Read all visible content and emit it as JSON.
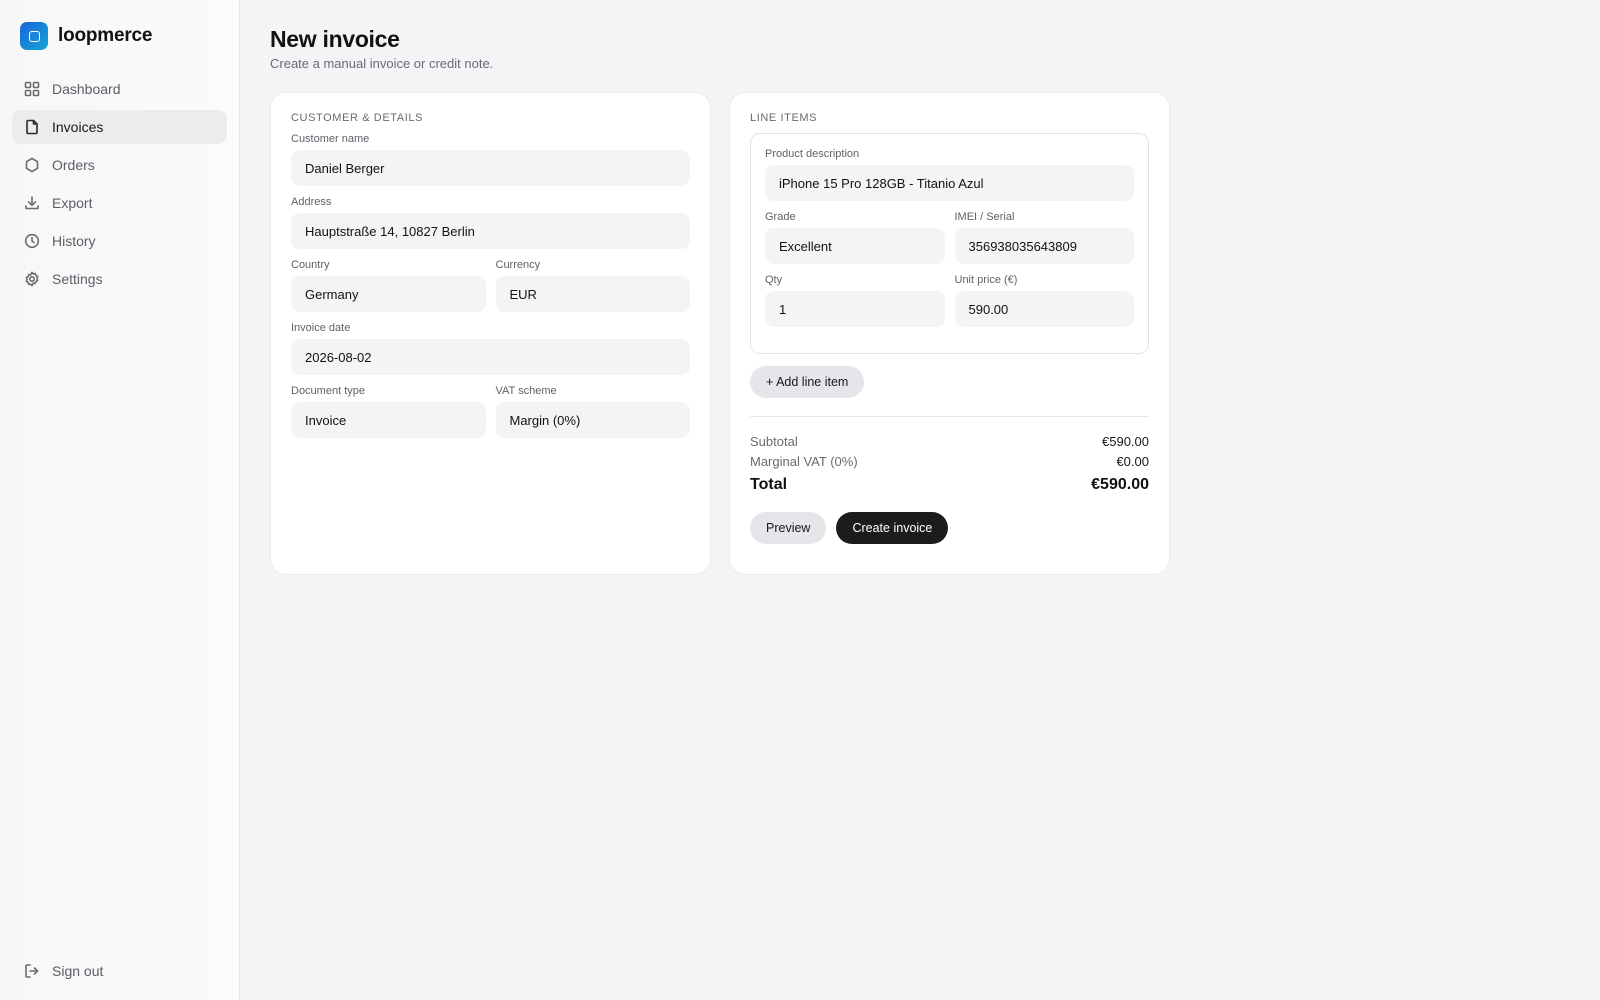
{
  "brand": {
    "name": "loopmerce",
    "accent": "#1a7ad8"
  },
  "sidebar": {
    "items": [
      {
        "label": "Dashboard",
        "icon": "grid-icon",
        "active": false
      },
      {
        "label": "Invoices",
        "icon": "document-icon",
        "active": true
      },
      {
        "label": "Orders",
        "icon": "box-icon",
        "active": false
      },
      {
        "label": "Export",
        "icon": "download-icon",
        "active": false
      },
      {
        "label": "History",
        "icon": "clock-icon",
        "active": false
      },
      {
        "label": "Settings",
        "icon": "gear-icon",
        "active": false
      }
    ],
    "signout": {
      "label": "Sign out",
      "icon": "sign-out-icon"
    }
  },
  "page": {
    "title": "New invoice",
    "subtitle": "Create a manual invoice or credit note."
  },
  "customer": {
    "section_title": "CUSTOMER & DETAILS",
    "name": {
      "label": "Customer name",
      "value": "Daniel Berger"
    },
    "address": {
      "label": "Address",
      "value": "Hauptstraße 14, 10827 Berlin"
    },
    "country": {
      "label": "Country",
      "value": "Germany"
    },
    "currency": {
      "label": "Currency",
      "value": "EUR"
    },
    "invoice_date": {
      "label": "Invoice date",
      "value": "2026-08-02"
    },
    "document_type": {
      "label": "Document type",
      "value": "Invoice"
    },
    "vat_scheme": {
      "label": "VAT scheme",
      "value": "Margin (0%)"
    }
  },
  "line_items": {
    "section_title": "LINE ITEMS",
    "items": [
      {
        "description": {
          "label": "Product description",
          "value": "iPhone 15 Pro 128GB - Titanio Azul"
        },
        "grade": {
          "label": "Grade",
          "value": "Excellent"
        },
        "imei": {
          "label": "IMEI / Serial",
          "value": "356938035643809"
        },
        "qty": {
          "label": "Qty",
          "value": "1"
        },
        "unit_price": {
          "label": "Unit price (€)",
          "value": "590.00"
        }
      }
    ],
    "add_label": "+ Add line item"
  },
  "totals": {
    "subtotal_label": "Subtotal",
    "subtotal_value": "€590.00",
    "vat_label": "Marginal VAT (0%)",
    "vat_value": "€0.00",
    "total_label": "Total",
    "total_value": "€590.00"
  },
  "actions": {
    "preview_label": "Preview",
    "create_label": "Create invoice"
  }
}
